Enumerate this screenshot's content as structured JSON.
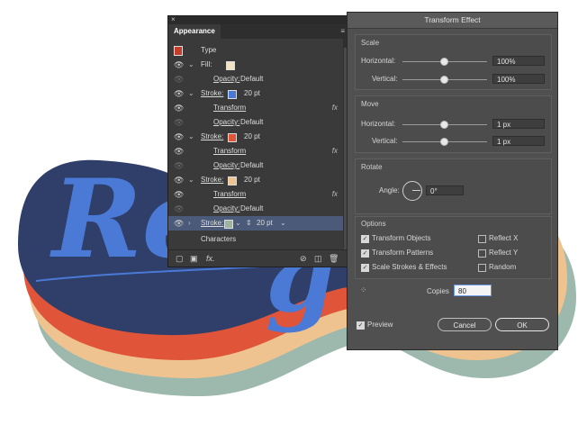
{
  "appearance": {
    "tab": "Appearance",
    "close": "×",
    "menu": "≡",
    "rows": [
      {
        "label": "Type"
      },
      {
        "label": "Fill:"
      },
      {
        "label": "Opacity:",
        "value": "Default"
      },
      {
        "label": "Stroke:",
        "value": "20 pt"
      },
      {
        "label": "Transform"
      },
      {
        "label": "Opacity:",
        "value": "Default"
      },
      {
        "label": "Stroke:",
        "value": "20 pt"
      },
      {
        "label": "Transform"
      },
      {
        "label": "Opacity:",
        "value": "Default"
      },
      {
        "label": "Stroke:",
        "value": "20 pt"
      },
      {
        "label": "Transform"
      },
      {
        "label": "Opacity:",
        "value": "Default"
      },
      {
        "label": "Stroke:",
        "value": "20 pt"
      },
      {
        "label": "Characters"
      }
    ],
    "fx": "fx",
    "bottom_fx": "fx."
  },
  "colors": {
    "fill": "#f3e3c3",
    "stroke_blue": "#4a7ad6",
    "stroke_red": "#e0553a",
    "stroke_tan": "#efc38f",
    "stroke_selected": "#9eb3a0",
    "navy": "#2f3f69",
    "teal": "#9db9ad"
  },
  "dialog": {
    "title": "Transform Effect",
    "scale": {
      "header": "Scale",
      "h_label": "Horizontal:",
      "h_value": "100%",
      "v_label": "Vertical:",
      "v_value": "100%"
    },
    "move": {
      "header": "Move",
      "h_label": "Horizontal:",
      "h_value": "1 px",
      "v_label": "Vertical:",
      "v_value": "1 px"
    },
    "rotate": {
      "header": "Rotate",
      "angle_label": "Angle:",
      "angle_value": "0°"
    },
    "options": {
      "header": "Options",
      "transform_objects": "Transform Objects",
      "transform_patterns": "Transform Patterns",
      "scale_strokes": "Scale Strokes & Effects",
      "reflect_x": "Reflect X",
      "reflect_y": "Reflect Y",
      "random": "Random"
    },
    "copies_label": "Copies",
    "copies_value": "80",
    "preview": "Preview",
    "cancel": "Cancel",
    "ok": "OK"
  }
}
